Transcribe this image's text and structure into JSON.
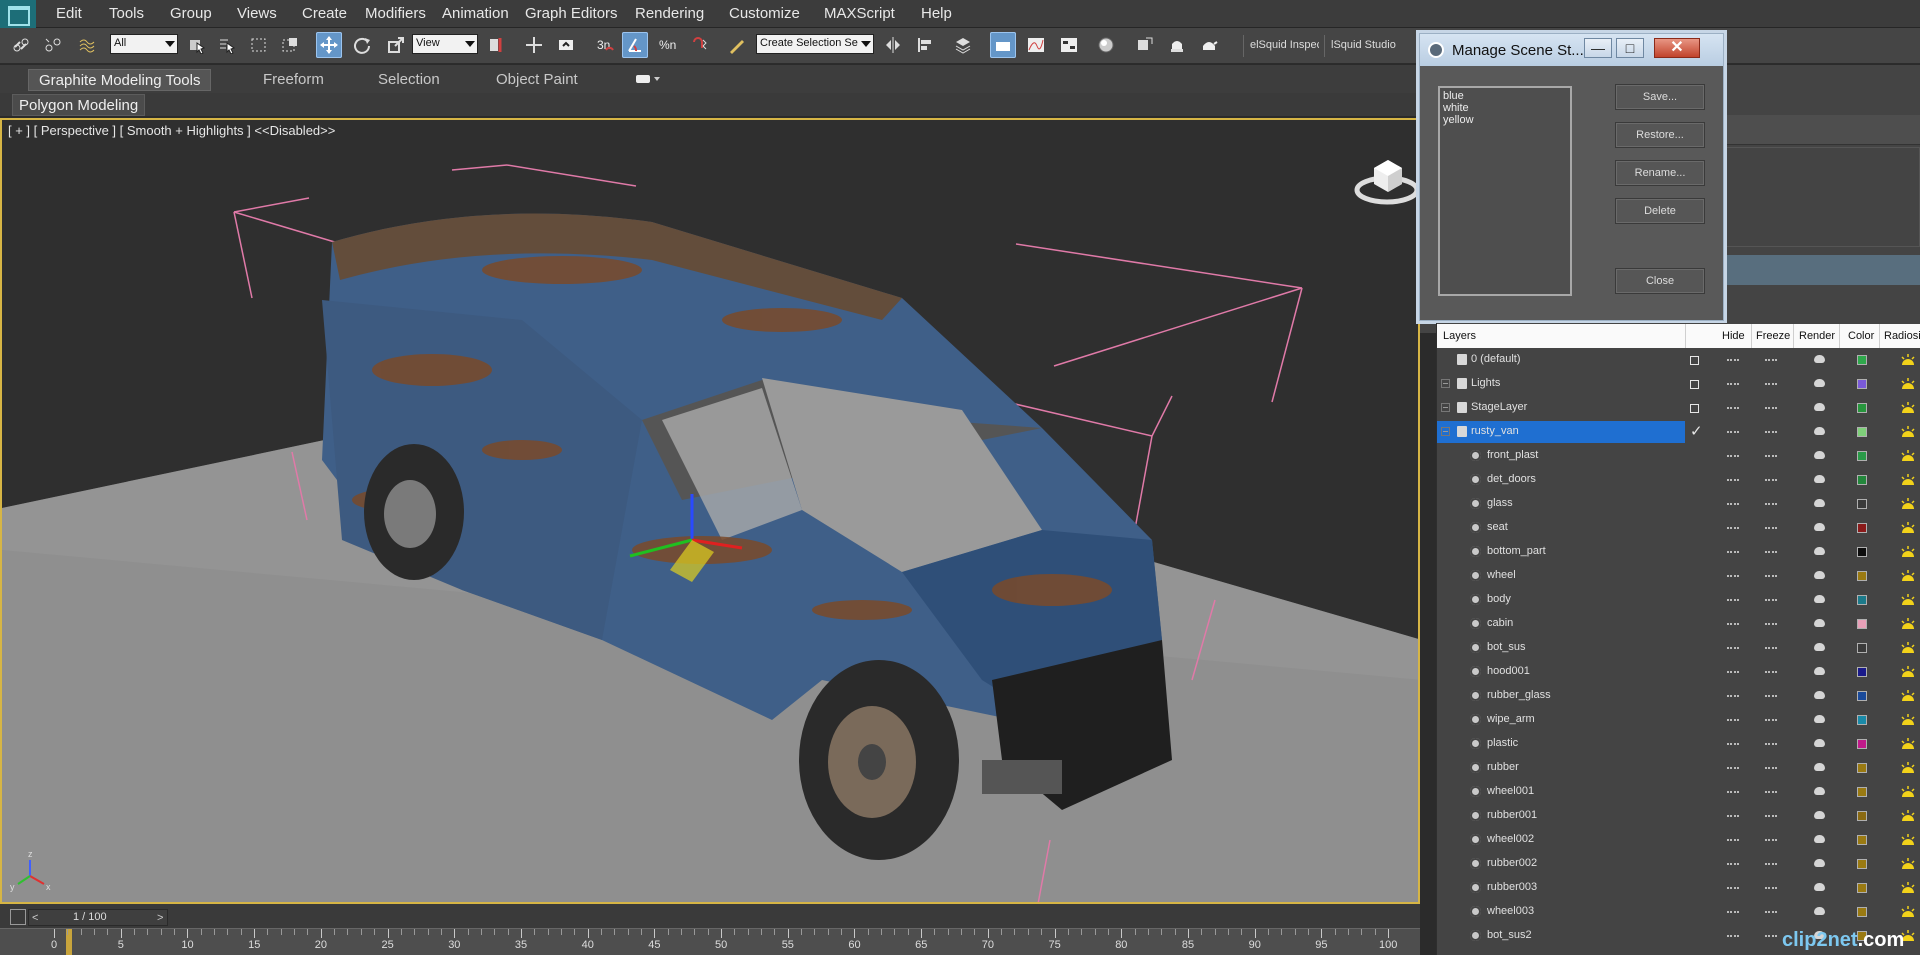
{
  "menubar": {
    "items": [
      "Edit",
      "Tools",
      "Group",
      "Views",
      "Create",
      "Modifiers",
      "Animation",
      "Graph Editors",
      "Rendering",
      "Customize",
      "MAXScript",
      "Help"
    ]
  },
  "toolbar": {
    "selection_filter": "All",
    "ref_coord": "View",
    "named_selection_placeholder": "Create Selection Se",
    "scene_explorer_btn1": "elSquid Inspec",
    "scene_explorer_btn2": "lSquid Studio •",
    "snap_label": "3n",
    "angle_label": "∠",
    "percent_label": "%n"
  },
  "ribbon": {
    "tabs": [
      "Graphite Modeling Tools",
      "Freeform",
      "Selection",
      "Object Paint"
    ],
    "active_tab": "Graphite Modeling Tools",
    "subtab": "Polygon Modeling"
  },
  "viewport": {
    "label": "[ + ] [ Perspective ] [ Smooth + Highlights ]  <<Disabled>>",
    "colors": {
      "border": "#d6b545",
      "floor": "#8f8f8f",
      "van_blue": "#3f5f88",
      "rust": "#7a4a2a",
      "lights": "#e07aa8"
    },
    "axis": {
      "x": "x",
      "y": "y",
      "z": "z"
    }
  },
  "dialog": {
    "title": "Manage Scene St...",
    "states": [
      "blue",
      "white",
      "yellow"
    ],
    "buttons": {
      "save": "Save...",
      "restore": "Restore...",
      "rename": "Rename...",
      "delete": "Delete",
      "close": "Close"
    }
  },
  "layers": {
    "columns": {
      "layers": "Layers",
      "hide": "Hide",
      "freeze": "Freeze",
      "render": "Render",
      "color": "Color",
      "radiosity": "Radiosi"
    },
    "rows": [
      {
        "name": "0 (default)",
        "kind": "layer",
        "expandable": false,
        "color": "#2fa84c",
        "current": "box"
      },
      {
        "name": "Lights",
        "kind": "layer",
        "expandable": true,
        "color": "#7a5ad8",
        "current": "box"
      },
      {
        "name": "StageLayer",
        "kind": "layer",
        "expandable": true,
        "color": "#27963d",
        "current": "box"
      },
      {
        "name": "rusty_van",
        "kind": "layer",
        "expandable": true,
        "color": "#7fd07a",
        "current": "check",
        "selected": true
      },
      {
        "name": "front_plast",
        "kind": "object",
        "color": "#2a9a48"
      },
      {
        "name": "det_doors",
        "kind": "object",
        "color": "#23873c"
      },
      {
        "name": "glass",
        "kind": "object",
        "color": "#3a3a3a"
      },
      {
        "name": "seat",
        "kind": "object",
        "color": "#8a1a1a"
      },
      {
        "name": "bottom_part",
        "kind": "object",
        "color": "#0d0d0d"
      },
      {
        "name": "wheel",
        "kind": "object",
        "color": "#9a7a12"
      },
      {
        "name": "body",
        "kind": "object",
        "color": "#1c7a8a"
      },
      {
        "name": "cabin",
        "kind": "object",
        "color": "#e8a0b8"
      },
      {
        "name": "bot_sus",
        "kind": "object",
        "color": "#3a3a3a"
      },
      {
        "name": "hood001",
        "kind": "object",
        "color": "#1a1a8a"
      },
      {
        "name": "rubber_glass",
        "kind": "object",
        "color": "#1a4a9a"
      },
      {
        "name": "wipe_arm",
        "kind": "object",
        "color": "#1a8aa8"
      },
      {
        "name": "plastic",
        "kind": "object",
        "color": "#c01a8a"
      },
      {
        "name": "rubber",
        "kind": "object",
        "color": "#9a7a12"
      },
      {
        "name": "wheel001",
        "kind": "object",
        "color": "#9a7a12"
      },
      {
        "name": "rubber001",
        "kind": "object",
        "color": "#8a6a12"
      },
      {
        "name": "wheel002",
        "kind": "object",
        "color": "#9a7a12"
      },
      {
        "name": "rubber002",
        "kind": "object",
        "color": "#9a7a12"
      },
      {
        "name": "rubber003",
        "kind": "object",
        "color": "#9a7a12"
      },
      {
        "name": "wheel003",
        "kind": "object",
        "color": "#9a7a12"
      },
      {
        "name": "bot_sus2",
        "kind": "object",
        "color": "#9a7a12"
      }
    ]
  },
  "timeline": {
    "frame_label": "1 / 100",
    "prev": "<",
    "next": ">",
    "ticks": [
      "0",
      "5",
      "10",
      "15",
      "20",
      "25",
      "30",
      "35",
      "40",
      "45",
      "50",
      "55",
      "60",
      "65",
      "70",
      "75",
      "80",
      "85",
      "90",
      "95",
      "100"
    ]
  },
  "watermark": {
    "text": "clip2net",
    "suffix": ".com"
  }
}
